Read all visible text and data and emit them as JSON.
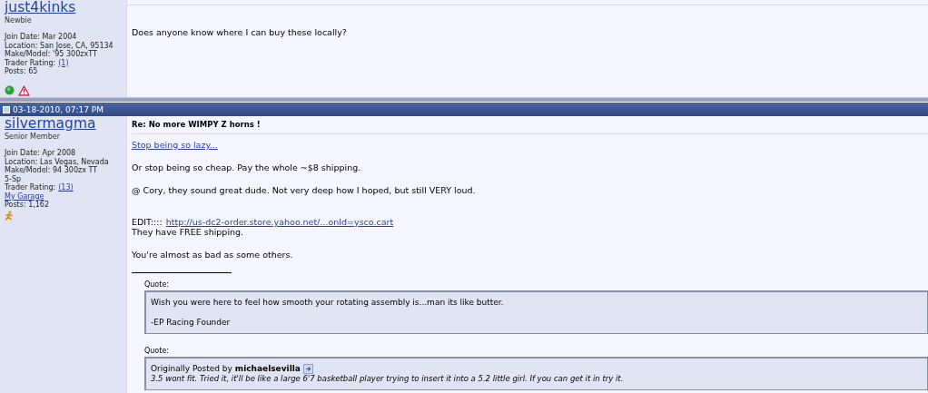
{
  "posts": [
    {
      "username": "just4kinks",
      "rank": "Newbie",
      "details": [
        {
          "kind": "text",
          "text": "Join Date: Mar 2004"
        },
        {
          "kind": "text",
          "text": "Location: San Jose, CA, 95134"
        },
        {
          "kind": "text",
          "text": "Make/Model: '95 300zxTT"
        },
        {
          "kind": "rating",
          "text": "Trader Rating:",
          "link": "(1)"
        },
        {
          "kind": "text",
          "text": "Posts: 65"
        }
      ],
      "icons": [
        {
          "kind": "online"
        },
        {
          "kind": "warning"
        }
      ],
      "blocks": [
        {
          "kind": "text",
          "text": "Does anyone know where I can buy these locally?"
        }
      ]
    },
    {
      "date": "03-18-2010, 07:17 PM",
      "username": "silvermagma",
      "rank": "Senior Member",
      "details": [
        {
          "kind": "text",
          "text": "Join Date: Apr 2008"
        },
        {
          "kind": "text",
          "text": "Location: Las Vegas, Nevada"
        },
        {
          "kind": "text",
          "text": "Make/Model: 94 300zx TT"
        },
        {
          "kind": "text",
          "text": "5-Sp"
        },
        {
          "kind": "rating",
          "text": "Trader Rating:",
          "link": "(13)"
        },
        {
          "kind": "link",
          "text": "My Garage"
        },
        {
          "kind": "text",
          "text": "Posts: 1,162"
        }
      ],
      "icons": [
        {
          "kind": "runner"
        }
      ],
      "title": "Re: No more WIMPY Z horns !",
      "blocks": [
        {
          "kind": "link",
          "text": "Stop being so lazy..."
        },
        {
          "kind": "text",
          "text": "Or stop being so cheap. Pay the whole ~$8 shipping."
        },
        {
          "kind": "text",
          "text": "@ Cory, they sound great dude. Not very deep how I hoped, but still VERY loud."
        },
        {
          "kind": "edit",
          "text": "EDIT::::",
          "link": "http://us-dc2-order.store.yahoo.net/...onId=ysco.cart",
          "after": "They have FREE shipping."
        },
        {
          "kind": "text",
          "text": "You're almost as bad as some others."
        }
      ],
      "quotes": [
        {
          "label": "Quote:",
          "lines": [
            "Wish you were here to feel how smooth your rotating assembly is...man its like butter.",
            "-EP Racing Founder"
          ]
        },
        {
          "label": "Quote:",
          "byline": "Originally Posted by **michaelsevilla**",
          "lines": [
            "3.5 wont fit. Tried it, it'll be like a large 6'7 basketball player trying to insert it into a 5.2 little girl. If you can get it in try it."
          ]
        }
      ]
    }
  ]
}
